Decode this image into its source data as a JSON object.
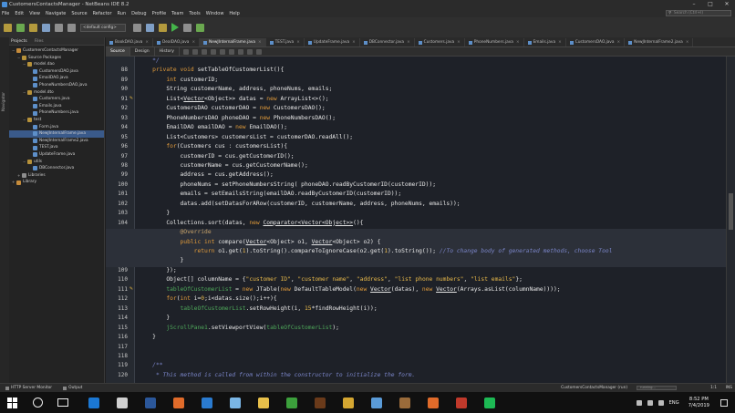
{
  "window": {
    "title": "CustomersContactsManager - NetBeans IDE 8.2"
  },
  "menu": [
    "File",
    "Edit",
    "View",
    "Navigate",
    "Source",
    "Refactor",
    "Run",
    "Debug",
    "Profile",
    "Team",
    "Tools",
    "Window",
    "Help"
  ],
  "search": {
    "placeholder": "Search (Ctrl+I)"
  },
  "toolbar": {
    "config": "<default config>"
  },
  "sidebar_strip": {
    "navigator_label": "Navigator"
  },
  "projects": {
    "tabs": [
      "Projects",
      "Files"
    ],
    "tree": [
      {
        "label": "CustomersContactsManager",
        "depth": 0,
        "type": "proj",
        "toggle": "−"
      },
      {
        "label": "Source Packages",
        "depth": 1,
        "type": "pkg",
        "toggle": "−"
      },
      {
        "label": "model.dao",
        "depth": 2,
        "type": "pkg",
        "toggle": "−"
      },
      {
        "label": "CustomersDAO.java",
        "depth": 3,
        "type": "java",
        "toggle": ""
      },
      {
        "label": "EmailDAO.java",
        "depth": 3,
        "type": "java",
        "toggle": ""
      },
      {
        "label": "PhoneNumbersDAO.java",
        "depth": 3,
        "type": "java",
        "toggle": ""
      },
      {
        "label": "model.dto",
        "depth": 2,
        "type": "pkg",
        "toggle": "−"
      },
      {
        "label": "Customers.java",
        "depth": 3,
        "type": "java",
        "toggle": ""
      },
      {
        "label": "Emails.java",
        "depth": 3,
        "type": "java",
        "toggle": ""
      },
      {
        "label": "PhoneNumbers.java",
        "depth": 3,
        "type": "java",
        "toggle": ""
      },
      {
        "label": "test",
        "depth": 2,
        "type": "pkg",
        "toggle": "−"
      },
      {
        "label": "Form.java",
        "depth": 3,
        "type": "java",
        "toggle": ""
      },
      {
        "label": "NewJInternalFrame.java",
        "depth": 3,
        "type": "java",
        "toggle": "",
        "selected": true
      },
      {
        "label": "NewJInternalFrame2.java",
        "depth": 3,
        "type": "java",
        "toggle": ""
      },
      {
        "label": "TEST.java",
        "depth": 3,
        "type": "java",
        "toggle": ""
      },
      {
        "label": "UpdateFrame.java",
        "depth": 3,
        "type": "java",
        "toggle": ""
      },
      {
        "label": "utils",
        "depth": 2,
        "type": "pkg",
        "toggle": "−"
      },
      {
        "label": "DBConnector.java",
        "depth": 3,
        "type": "java",
        "toggle": ""
      },
      {
        "label": "Libraries",
        "depth": 1,
        "type": "lib",
        "toggle": "+"
      },
      {
        "label": "Library",
        "depth": 0,
        "type": "proj",
        "toggle": "+"
      }
    ]
  },
  "editor_tabs": [
    {
      "label": "BookDAO.java",
      "active": false
    },
    {
      "label": "DealDAO.java",
      "active": false
    },
    {
      "label": "NewJInternalFrame.java",
      "active": true
    },
    {
      "label": "TEST.java",
      "active": false
    },
    {
      "label": "UpdateFrame.java",
      "active": false
    },
    {
      "label": "DBConnector.java",
      "active": false
    },
    {
      "label": "Customers.java",
      "active": false
    },
    {
      "label": "PhoneNumbers.java",
      "active": false
    },
    {
      "label": "Emails.java",
      "active": false
    },
    {
      "label": "CustomersDAO.java",
      "active": false
    },
    {
      "label": "NewJInternalFrame2.java",
      "active": false
    }
  ],
  "editor_subtabs": [
    {
      "label": "Source",
      "active": true
    },
    {
      "label": "Design",
      "active": false
    },
    {
      "label": "History",
      "active": false
    }
  ],
  "code": {
    "lines": [
      {
        "n": "",
        "mark": "",
        "hl": false,
        "html": "    <span class=\"c\">*/</span>"
      },
      {
        "n": "88",
        "mark": "",
        "hl": false,
        "html": "    <span class=\"k\">private void</span> setTableOfCustomerList(){"
      },
      {
        "n": "89",
        "mark": "",
        "hl": false,
        "html": "        <span class=\"k\">int</span> customerID;"
      },
      {
        "n": "90",
        "mark": "",
        "hl": false,
        "html": "        String customerName, address, phoneNums, emails;"
      },
      {
        "n": "91",
        "mark": "✎",
        "hl": false,
        "html": "        List&lt;<span class=\"u\">Vector</span>&lt;Object&gt;&gt; datas = <span class=\"k\">new</span> ArrayList&lt;&gt;();"
      },
      {
        "n": "92",
        "mark": "",
        "hl": false,
        "html": "        CustomersDAO customerDAO = <span class=\"k\">new</span> CustomersDAO();"
      },
      {
        "n": "93",
        "mark": "",
        "hl": false,
        "html": "        PhoneNumbersDAO phoneDAO = <span class=\"k\">new</span> PhoneNumbersDAO();"
      },
      {
        "n": "94",
        "mark": "",
        "hl": false,
        "html": "        EmailDAO emailDAO = <span class=\"k\">new</span> EmailDAO();"
      },
      {
        "n": "95",
        "mark": "",
        "hl": false,
        "html": "        List&lt;Customers&gt; customersList = customerDAO.readAll();"
      },
      {
        "n": "96",
        "mark": "",
        "hl": false,
        "html": "        <span class=\"k\">for</span>(Customers cus : customersList){"
      },
      {
        "n": "97",
        "mark": "",
        "hl": false,
        "html": "            customerID = cus.getCustomerID();"
      },
      {
        "n": "98",
        "mark": "",
        "hl": false,
        "html": "            customerName = cus.getCustomerName();"
      },
      {
        "n": "99",
        "mark": "",
        "hl": false,
        "html": "            address = cus.getAddress();"
      },
      {
        "n": "100",
        "mark": "",
        "hl": false,
        "html": "            phoneNums = setPhoneNumbersString( phoneDAO.readByCustomerID(customerID));"
      },
      {
        "n": "101",
        "mark": "",
        "hl": false,
        "html": "            emails = setEmailsString(emailDAO.readByCustomerID(customerID));"
      },
      {
        "n": "102",
        "mark": "",
        "hl": false,
        "html": "            datas.add(setDatasForARow(customerID, customerName, address, phoneNums, emails));"
      },
      {
        "n": "103",
        "mark": "",
        "hl": false,
        "html": "        }"
      },
      {
        "n": "104",
        "mark": "",
        "hl": false,
        "html": "        Collections.sort(datas, <span class=\"k\">new</span> <span class=\"u\">Comparator&lt;Vector&lt;Object&gt;&gt;</span>(){"
      },
      {
        "n": "105",
        "mark": "",
        "hl": true,
        "html": "            <span class=\"a\">@Override</span>"
      },
      {
        "n": "106",
        "mark": "●",
        "hl": true,
        "html": "            <span class=\"k\">public int</span> compare(<span class=\"u\">Vector</span>&lt;Object&gt; o1, <span class=\"u\">Vector</span>&lt;Object&gt; o2) {"
      },
      {
        "n": "107",
        "mark": "",
        "hl": true,
        "html": "                <span class=\"k\">return</span> o1.get(<span class=\"n\">1</span>).toString().compareToIgnoreCase(o2.get(<span class=\"n\">1</span>).toString()); <span class=\"c\">//To change body of generated methods, choose Tool</span>"
      },
      {
        "n": "108",
        "mark": "",
        "hl": true,
        "html": "            }"
      },
      {
        "n": "109",
        "mark": "",
        "hl": false,
        "html": "        });"
      },
      {
        "n": "110",
        "mark": "",
        "hl": false,
        "html": "        Object[] columnName = {<span class=\"s\">\"customer ID\"</span>, <span class=\"s\">\"customer name\"</span>, <span class=\"s\">\"address\"</span>, <span class=\"s\">\"list phone numbers\"</span>, <span class=\"s\">\"list emails\"</span>};"
      },
      {
        "n": "111",
        "mark": "✎",
        "hl": false,
        "html": "        <span class=\"fd\">tableOfCustomerList</span> = <span class=\"k\">new</span> JTable(<span class=\"k\">new</span> DefaultTableModel(<span class=\"k\">new</span> <span class=\"u\">Vector</span>(datas), <span class=\"k\">new</span> <span class=\"u\">Vector</span>(Arrays.asList(columnName))));"
      },
      {
        "n": "112",
        "mark": "",
        "hl": false,
        "html": "        <span class=\"k\">for</span>(<span class=\"k\">int</span> i=<span class=\"n\">0</span>;i&lt;datas.size();i++){"
      },
      {
        "n": "113",
        "mark": "",
        "hl": false,
        "html": "            <span class=\"fd\">tableOfCustomerList</span>.setRowHeight(i, <span class=\"n\">15</span>*findRowHeight(i));"
      },
      {
        "n": "114",
        "mark": "",
        "hl": false,
        "html": "        }"
      },
      {
        "n": "115",
        "mark": "",
        "hl": false,
        "html": "        <span class=\"fd\">jScrollPane1</span>.setViewportView(<span class=\"fd\">tableOfCustomerList</span>);"
      },
      {
        "n": "116",
        "mark": "",
        "hl": false,
        "html": "    }"
      },
      {
        "n": "117",
        "mark": "",
        "hl": false,
        "html": ""
      },
      {
        "n": "118",
        "mark": "",
        "hl": false,
        "html": ""
      },
      {
        "n": "119",
        "mark": "",
        "hl": false,
        "html": "    <span class=\"c\">/**</span>"
      },
      {
        "n": "120",
        "mark": "",
        "hl": false,
        "html": "     <span class=\"c\">* This method is called from within the constructor to initialize the form.</span>"
      }
    ]
  },
  "bottom": {
    "items": [
      "HTTP Server Monitor",
      "Output"
    ],
    "status": "CustomersContactsManager (run)",
    "progress_label": "running...",
    "position": "1:1",
    "mode": "INS"
  },
  "taskbar": {
    "lang": "ENG",
    "time": "8:52 PM",
    "date": "7/4/2019",
    "apps": [
      {
        "name": "edge-icon",
        "color": "#1b78d4"
      },
      {
        "name": "store-icon",
        "color": "#d0d0d0"
      },
      {
        "name": "word-icon",
        "color": "#2b579a"
      },
      {
        "name": "java-icon",
        "color": "#e06b2a"
      },
      {
        "name": "vscode-icon",
        "color": "#2a7bd0"
      },
      {
        "name": "netbeans-icon",
        "color": "#7ab6e6"
      },
      {
        "name": "file-explorer-icon",
        "color": "#e8c04a"
      },
      {
        "name": "dreamweaver-icon",
        "color": "#3ca03c"
      },
      {
        "name": "illustrator-icon",
        "color": "#6a3a1a"
      },
      {
        "name": "chrome-icon",
        "color": "#d4a631"
      },
      {
        "name": "netbeans-cube-icon",
        "color": "#5a9bd8"
      },
      {
        "name": "scratch-icon",
        "color": "#9a6b3a"
      },
      {
        "name": "xampp-icon",
        "color": "#e06b2a"
      },
      {
        "name": "filezilla-icon",
        "color": "#c0392b"
      },
      {
        "name": "spotify-icon",
        "color": "#1db954"
      }
    ]
  }
}
